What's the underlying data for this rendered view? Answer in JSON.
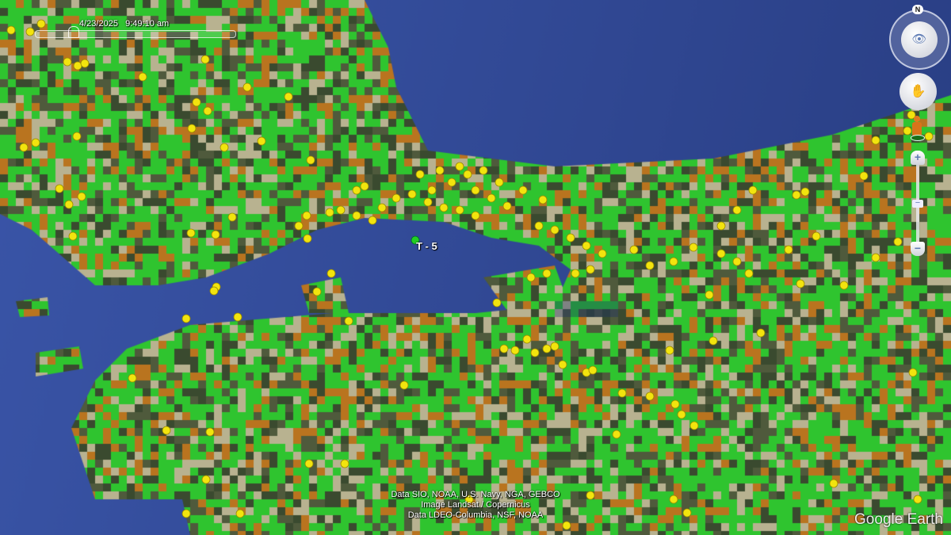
{
  "time_slider": {
    "date": "4/23/2025",
    "time": "9:49:10 am",
    "position": 0.19
  },
  "placemark_label": "T - 5",
  "attribution": [
    "Data SIO, NOAA, U.S. Navy, NGA, GEBCO",
    "Image Landsat / Copernicus",
    "Data LDEO-Columbia, NSF, NOAA"
  ],
  "logo": "Google Earth",
  "navigation": {
    "north_label": "N",
    "zoom_in": "+",
    "zoom_out": "−",
    "zoom_level": 0.45
  },
  "colors": {
    "sea": "#2f4795",
    "green": "#2fc42f",
    "brown": "#b9741f",
    "tan": "#b8b290",
    "dark": "#3a4a2f",
    "marker": "#f2e40e"
  }
}
